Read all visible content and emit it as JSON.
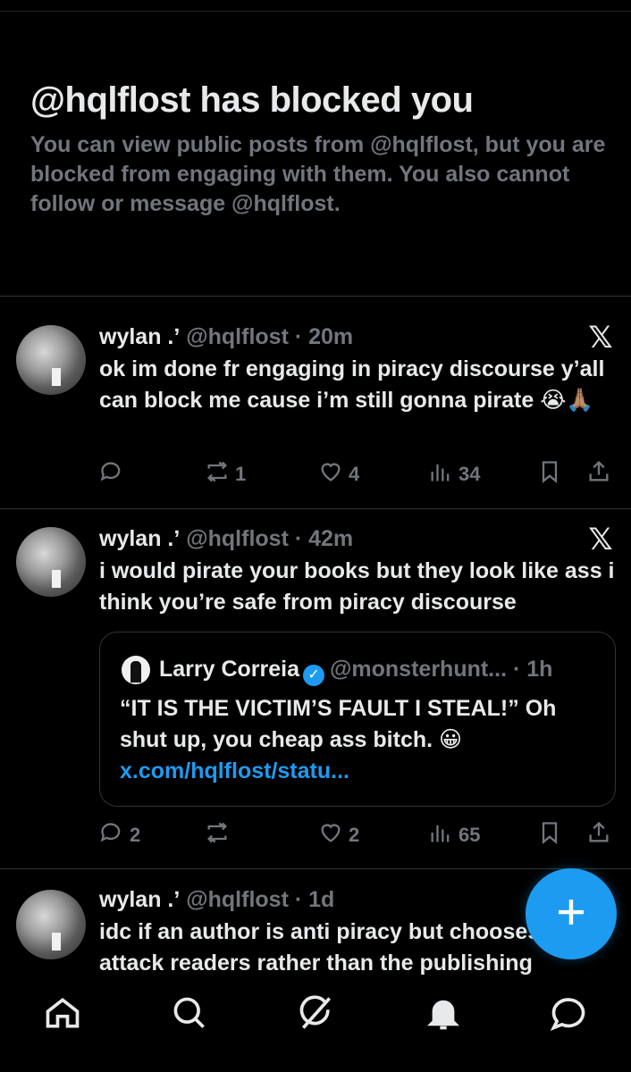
{
  "blocked": {
    "title": "@hqlflost has blocked you",
    "description": "You can view public posts from @hqlflost, but you are blocked from engaging with them. You also cannot follow or message @hqlflost."
  },
  "posts": [
    {
      "name": "wylan .ʼ",
      "meta": "@hqlflost · 20m",
      "text": "ok im done fr engaging in piracy discourse y’all can block me cause i’m still gonna pirate 😭🙏🏽",
      "replies": "",
      "reposts": "1",
      "likes": "4",
      "views": "34"
    },
    {
      "name": "wylan .ʼ",
      "meta": "@hqlflost · 42m",
      "text": "i would pirate your books but they look like ass i think you’re safe from piracy discourse",
      "replies": "2",
      "reposts": "",
      "likes": "2",
      "views": "65",
      "quote": {
        "name": "Larry Correia",
        "meta": "@monsterhunt... · 1h",
        "text": "“IT IS THE VICTIM’S FAULT I STEAL!” Oh shut up, you cheap ass bitch. 😀",
        "link": "x.com/hqlflost/statu..."
      }
    },
    {
      "name": "wylan .ʼ",
      "meta": "@hqlflost · 1d",
      "text": "idc if an author is anti piracy but chooses to attack readers rather than the publishing"
    }
  ],
  "icons": {
    "x_logo": "x-logo-icon",
    "reply": "reply-icon",
    "repost": "repost-icon",
    "like": "heart-icon",
    "views": "views-icon",
    "bookmark": "bookmark-icon",
    "share": "share-icon",
    "compose": "plus-icon",
    "nav": [
      "home-icon",
      "search-icon",
      "grok-icon",
      "bell-icon",
      "messages-icon"
    ]
  },
  "colors": {
    "background": "#000000",
    "text": "#e7e9ea",
    "muted": "#71767b",
    "accent": "#1d9bf0",
    "divider": "#2f3336"
  }
}
